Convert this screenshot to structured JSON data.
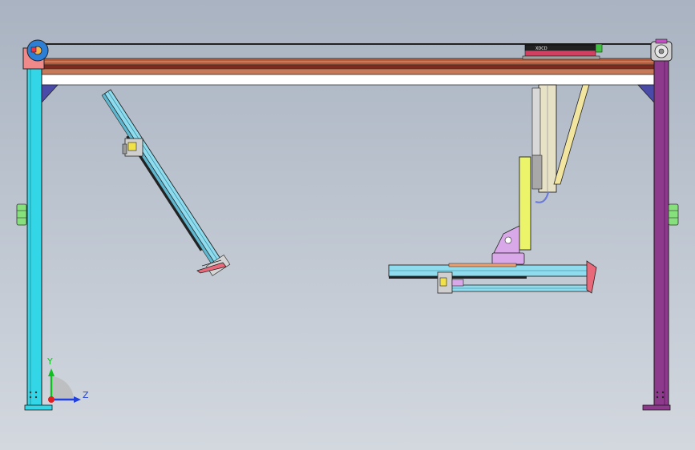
{
  "viewport": {
    "background_top": "#a9b3c1",
    "background_bottom": "#d3d8df"
  },
  "frame": {
    "left_column_color": "#33d6e6",
    "right_column_color": "#8e3a8c",
    "beam_color": "#b55a3a",
    "beam_face_color": "#ffffff",
    "bracket_color": "#4a4aa8",
    "pad_color": "#86e07c"
  },
  "carriage": {
    "label": "XDCD"
  },
  "triad": {
    "y_label": "Y",
    "z_label": "Z",
    "x_color": "#e02020",
    "y_color": "#10c020",
    "z_color": "#2040e0"
  },
  "icons": {
    "left_pulley": "pulley-icon",
    "right_gearbox": "gearbox-icon",
    "triad": "coordinate-triad-icon"
  }
}
